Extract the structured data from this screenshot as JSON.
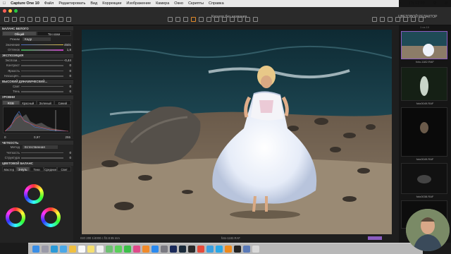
{
  "menubar": {
    "app": "Capture One 10",
    "items": [
      "Файл",
      "Редактировать",
      "Вид",
      "Коррекции",
      "Изображение",
      "Камера",
      "Окно",
      "Скрипты",
      "Справка"
    ],
    "clock": "Пт 17:20"
  },
  "toolbar": {
    "window_title": "Каталог без названия",
    "viewer_title": "ЦВЕТОВОЙ РЕДАКТОР"
  },
  "left_panel": {
    "white_balance": {
      "title": "БАЛАНС БЕЛОГО",
      "tabs": [
        "Общий",
        "Тон кожи"
      ],
      "mode_label": "Режим",
      "mode_value": "Кадр",
      "rows": [
        {
          "label": "Значение",
          "value": "4501"
        },
        {
          "label": "Оттенок",
          "value": "1,8"
        }
      ]
    },
    "exposure": {
      "title": "ЭКСПОЗИЦИЯ",
      "rows": [
        {
          "label": "Экспози...",
          "value": "-0,44"
        },
        {
          "label": "Контраст",
          "value": "0"
        },
        {
          "label": "Яркость",
          "value": "0"
        },
        {
          "label": "Насыщен...",
          "value": "0"
        }
      ]
    },
    "hdr": {
      "title": "ВЫСОКИЙ ДИНАМИЧЕСКИЙ...",
      "rows": [
        {
          "label": "Свет",
          "value": "0"
        },
        {
          "label": "Тень",
          "value": "0"
        }
      ]
    },
    "levels": {
      "title": "УРОВНИ",
      "tabs": [
        "RGB",
        "Красный",
        "Зеленый",
        "Синий"
      ],
      "low": "0",
      "high": "255",
      "gamma": "0,97"
    },
    "sharpness": {
      "title": "ЧЕТКОСТЬ",
      "method_label": "Метод",
      "method_value": "Естественная",
      "rows": [
        {
          "label": "Четкость",
          "value": "0"
        },
        {
          "label": "Структура",
          "value": "0"
        }
      ]
    },
    "color_balance": {
      "title": "ЦВЕТОВОЙ БАЛАНС",
      "tabs": [
        "Мастер",
        "3-путь",
        "Тени",
        "Средние",
        "Свет"
      ]
    }
  },
  "viewer": {
    "status_left": "ISO 200  1/4000 с  f/2.8  85 mm",
    "status_center": "foto-1182.RAF"
  },
  "browser": {
    "counter": "1 из 10",
    "thumbs": [
      {
        "caption": "foto-1182.RAF"
      },
      {
        "caption": "foto0049.RAF"
      },
      {
        "caption": "foto0049.RAF"
      },
      {
        "caption": "foto0038.RAF"
      },
      {
        "caption": ""
      }
    ]
  },
  "colors": {
    "accent": "#8a5cc0",
    "panel": "#232323",
    "viewer_bg": "#1e1e1e"
  }
}
